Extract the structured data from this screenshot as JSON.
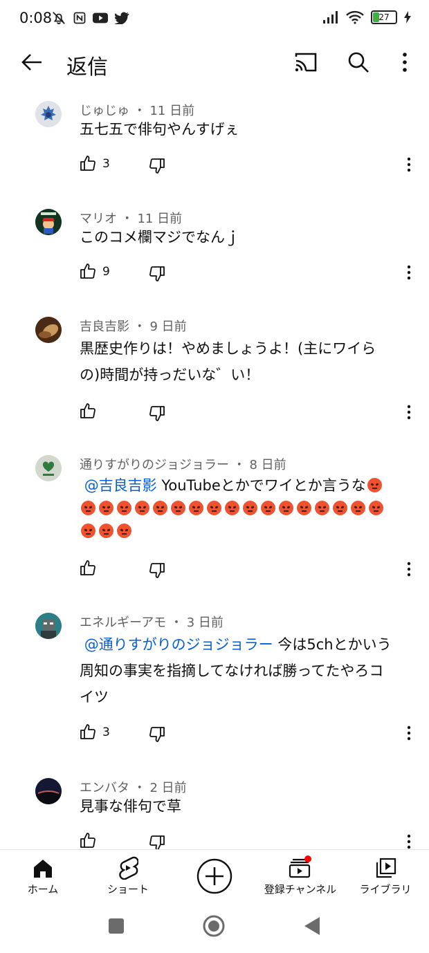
{
  "status": {
    "time": "0:08",
    "battery": "27"
  },
  "header": {
    "title": "返信"
  },
  "comments": [
    {
      "author": "じゅじゅ",
      "age": "11 日前",
      "text": "五七五で俳句やんすげぇ",
      "likes": "3"
    },
    {
      "author": "マリオ",
      "age": "11 日前",
      "text": "このコメ欄マジでなんｊ",
      "likes": "9"
    },
    {
      "author": "吉良吉影",
      "age": "9 日前",
      "line1": "黒歴史作りは！やめましょうよ！(主にワイら",
      "line2": "の)時間が持っだいな゛い！",
      "likes": ""
    },
    {
      "author": "通りすがりのジョジョラー",
      "age": "8 日前",
      "mention": "@吉良吉影",
      "text": " YouTubeとかでワイとか言うな",
      "likes": ""
    },
    {
      "author": "エネルギーアモ",
      "age": "3 日前",
      "mention": "@通りすがりのジョジョラー",
      "text": " 今は5chとかいう",
      "line2": "周知の事実を指摘してなければ勝ってたやろコ",
      "line3": "イツ",
      "likes": "3"
    },
    {
      "author": "エンバタ",
      "age": "2 日前",
      "text": "見事な俳句で草",
      "likes": ""
    }
  ],
  "nav": {
    "home": "ホーム",
    "shorts": "ショート",
    "subs": "登録チャンネル",
    "library": "ライブラリ"
  },
  "colors": {
    "mention": "#065fd4",
    "meta": "#606060",
    "badge": "#ff0000"
  }
}
